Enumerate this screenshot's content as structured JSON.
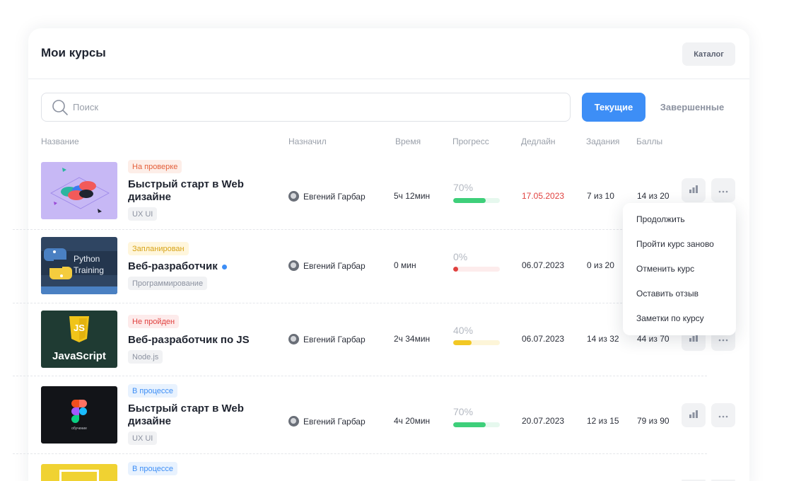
{
  "header": {
    "title": "Мои курсы",
    "catalog_label": "Каталог"
  },
  "search": {
    "placeholder": "Поиск",
    "value": ""
  },
  "tabs": {
    "current": "Текущие",
    "finished": "Завершенные"
  },
  "columns": {
    "name": "Название",
    "assigned": "Назначил",
    "time": "Время",
    "progress": "Прогресс",
    "deadline": "Дедлайн",
    "tasks": "Задания",
    "points": "Баллы"
  },
  "courses": [
    {
      "status": "На проверке",
      "title": "Быстрый старт в Web дизайне",
      "tag": "UX UI",
      "assignee": "Евгений  Гарбар",
      "time": "5ч 12мин",
      "progress_text": "70%",
      "progress": 0.7,
      "deadline": "17.05.2023",
      "tasks": "7 из 10",
      "points": "14 из 20"
    },
    {
      "status": "Запланирован",
      "title": "Веб-разработчик",
      "tag": "Программирование",
      "assignee": "Евгений  Гарбар",
      "time": "0 мин",
      "progress_text": "0%",
      "progress": 0.0,
      "deadline": "06.07.2023",
      "tasks": "0 из 20",
      "points": ""
    },
    {
      "status": "Не пройден",
      "title": "Веб-разработчик по JS",
      "tag": "Node.js",
      "assignee": "Евгений  Гарбар",
      "time": "2ч 34мин",
      "progress_text": "40%",
      "progress": 0.4,
      "deadline": "06.07.2023",
      "tasks": "14 из 32",
      "points": "44 из 70"
    },
    {
      "status": "В процессе",
      "title": "Быстрый старт в Web дизайне",
      "tag": "UX UI",
      "assignee": "Евгений  Гарбар",
      "time": "4ч 20мин",
      "progress_text": "70%",
      "progress": 0.7,
      "deadline": "20.07.2023",
      "tasks": "12 из 15",
      "points": "79 из 90"
    },
    {
      "status": "В процессе"
    }
  ],
  "thumb_text": {
    "python_line1": "Python",
    "python_line2": "Training",
    "js_logo": "JS",
    "js_label": "JavaScript",
    "figma_caption": "обучение"
  },
  "context_menu": [
    "Продолжить",
    "Пройти курс заново",
    "Отменить курс",
    "Оставить отзыв",
    "Заметки по курсу"
  ],
  "colors": {
    "accent": "#3d8ef6",
    "deadline_overdue": "#e0413f",
    "bar_green": "#3ecf7a",
    "bar_red": "#e0413f",
    "bar_yellow": "#f2c824",
    "track_green": "#e6f8ee",
    "track_red": "#fdecec",
    "track_yellow": "#fdf5d8"
  },
  "icons": {
    "search": "search-icon",
    "stats": "bar-chart-icon",
    "more": "more-dots-icon"
  }
}
